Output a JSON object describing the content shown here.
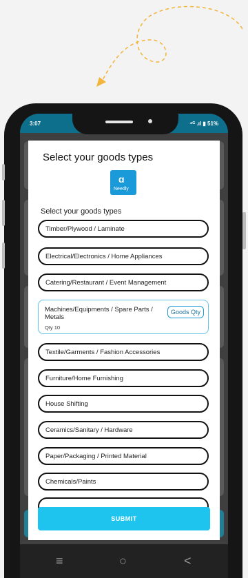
{
  "status_bar": {
    "time": "3:07",
    "right": "⁴ᴳ .ıl ▮ 51%"
  },
  "dialog": {
    "title": "Select your goods types",
    "logo_text": "Needly",
    "subtitle": "Select your goods types",
    "items": [
      {
        "label": "Timber/Plywood / Laminate"
      },
      {
        "label": "Electrical/Electronics / Home Appliances"
      },
      {
        "label": "Catering/Restaurant / Event Management"
      },
      {
        "label": "Machines/Equipments / Spare Parts / Metals",
        "qty": "Qty 10",
        "qty_button": "Goods Qty"
      },
      {
        "label": "Textile/Garments / Fashion Accessories"
      },
      {
        "label": "Furniture/Home Furnishing"
      },
      {
        "label": "House Shifting"
      },
      {
        "label": "Ceramics/Sanitary / Hardware"
      },
      {
        "label": "Paper/Packaging / Printed Material"
      },
      {
        "label": "Chemicals/Paints"
      }
    ],
    "submit_label": "SUBMIT"
  },
  "nav_icons": {
    "menu": "≡",
    "home": "○",
    "back": "<"
  },
  "colors": {
    "accent": "#1ec4ee",
    "brand": "#1a9ad9",
    "statusbar": "#0d6f8c"
  }
}
